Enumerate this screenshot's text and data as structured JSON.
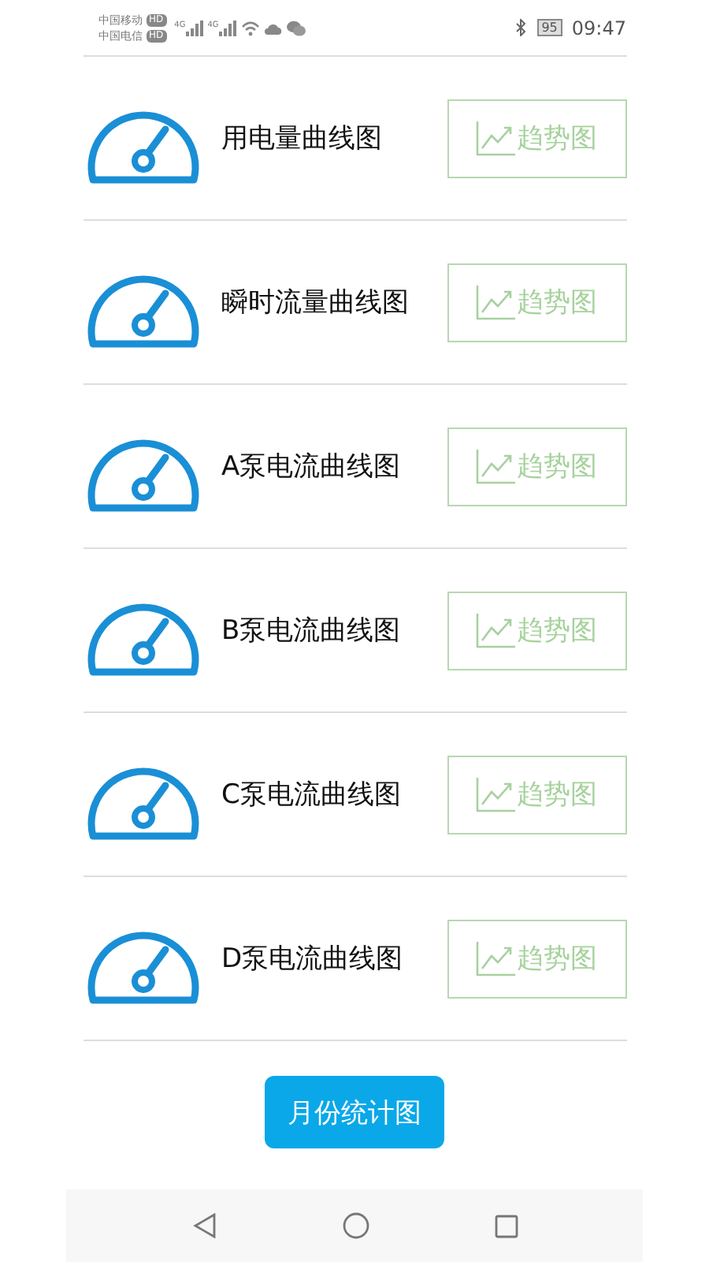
{
  "status_bar": {
    "carriers": [
      {
        "name": "中国移动",
        "badge": "HD"
      },
      {
        "name": "中国电信",
        "badge": "HD"
      }
    ],
    "signals": [
      "4G",
      "4G"
    ],
    "battery": "95",
    "time": "09:47"
  },
  "rows": [
    {
      "title": "用电量曲线图",
      "button": "趋势图"
    },
    {
      "title": "瞬时流量曲线图",
      "button": "趋势图"
    },
    {
      "title": "A泵电流曲线图",
      "button": "趋势图"
    },
    {
      "title": "B泵电流曲线图",
      "button": "趋势图"
    },
    {
      "title": "C泵电流曲线图",
      "button": "趋势图"
    },
    {
      "title": "D泵电流曲线图",
      "button": "趋势图"
    }
  ],
  "footer_button": "月份统计图"
}
